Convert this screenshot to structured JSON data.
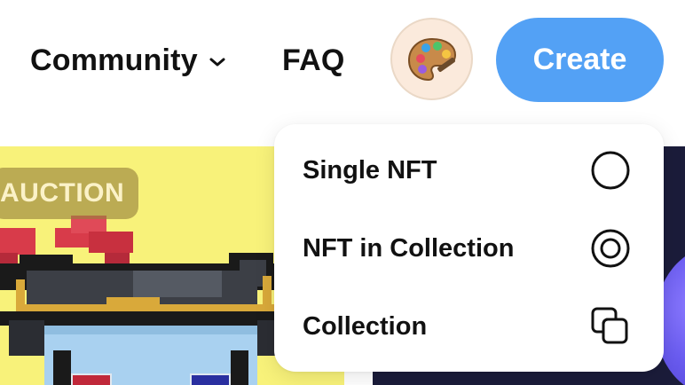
{
  "header": {
    "nav": {
      "community_label": "Community",
      "faq_label": "FAQ"
    },
    "avatar_icon": "palette-icon",
    "create_label": "Create"
  },
  "background": {
    "left_card": {
      "badge_label": "AUCTION",
      "color": "#f8f27a"
    },
    "right_card": {
      "color": "#1b1c3a"
    }
  },
  "create_menu": {
    "items": [
      {
        "label": "Single NFT",
        "icon": "circle-outline-icon"
      },
      {
        "label": "NFT in Collection",
        "icon": "concentric-circle-icon"
      },
      {
        "label": "Collection",
        "icon": "stacked-squares-icon"
      }
    ]
  },
  "colors": {
    "accent": "#53a1f5",
    "text": "#111111"
  }
}
